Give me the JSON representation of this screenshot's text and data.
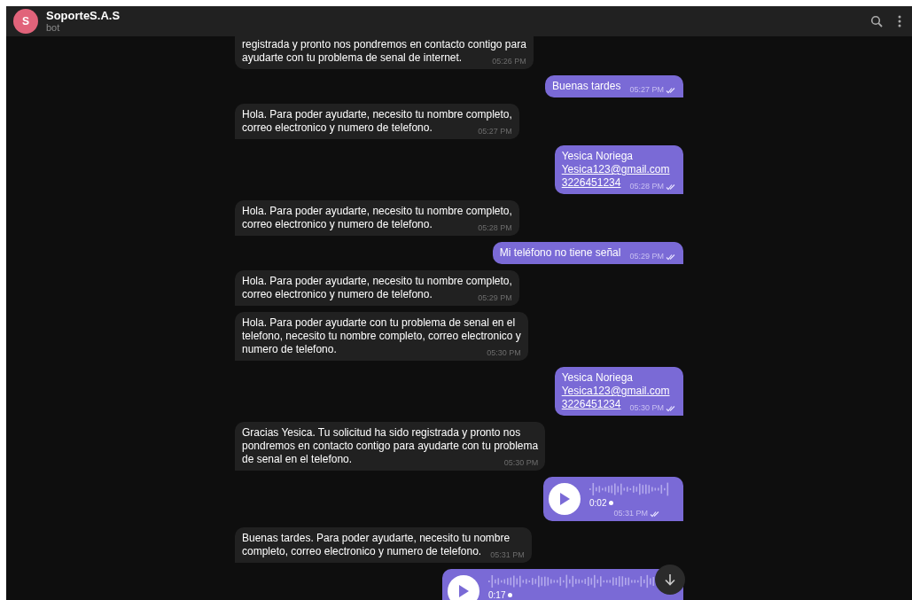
{
  "header": {
    "avatar_letter": "S",
    "title": "SoporteS.A.S",
    "subtitle": "bot"
  },
  "messages": [
    {
      "kind": "text",
      "outgoing": false,
      "lines": [
        {
          "text": "registrada y pronto nos pondremos en contacto contigo para"
        },
        {
          "text": "ayudarte con tu problema de senal de internet."
        }
      ],
      "time": "05:26 PM"
    },
    {
      "kind": "text",
      "outgoing": true,
      "lines": [
        {
          "text": "Buenas tardes"
        }
      ],
      "time": "05:27 PM",
      "read": true
    },
    {
      "kind": "text",
      "outgoing": false,
      "lines": [
        {
          "text": "Hola. Para poder ayudarte, necesito tu nombre completo,"
        },
        {
          "text": "correo electronico y numero de telefono."
        }
      ],
      "time": "05:27 PM"
    },
    {
      "kind": "text",
      "outgoing": true,
      "lines": [
        {
          "text": "Yesica Noriega",
          "link": false
        },
        {
          "text": "Yesica123@gmail.com",
          "link": true
        },
        {
          "text": "3226451234",
          "link": true
        }
      ],
      "time": "05:28 PM",
      "read": true
    },
    {
      "kind": "text",
      "outgoing": false,
      "lines": [
        {
          "text": "Hola. Para poder ayudarte, necesito tu nombre completo,"
        },
        {
          "text": "correo electronico y numero de telefono."
        }
      ],
      "time": "05:28 PM"
    },
    {
      "kind": "text",
      "outgoing": true,
      "lines": [
        {
          "text": "Mi teléfono no tiene señal"
        }
      ],
      "time": "05:29 PM",
      "read": true
    },
    {
      "kind": "text",
      "outgoing": false,
      "lines": [
        {
          "text": "Hola. Para poder ayudarte, necesito tu nombre completo,"
        },
        {
          "text": "correo electronico y numero de telefono."
        }
      ],
      "time": "05:29 PM"
    },
    {
      "kind": "text",
      "outgoing": false,
      "lines": [
        {
          "text": "Hola. Para poder ayudarte con tu problema de senal en el"
        },
        {
          "text": "telefono, necesito tu nombre completo, correo electronico y"
        },
        {
          "text": "numero de telefono."
        }
      ],
      "time": "05:30 PM"
    },
    {
      "kind": "text",
      "outgoing": true,
      "lines": [
        {
          "text": "Yesica Noriega",
          "link": false
        },
        {
          "text": "Yesica123@gmail.com",
          "link": true
        },
        {
          "text": "3226451234",
          "link": true
        }
      ],
      "time": "05:30 PM",
      "read": true
    },
    {
      "kind": "text",
      "outgoing": false,
      "lines": [
        {
          "text": "Gracias Yesica. Tu solicitud ha sido registrada y pronto nos"
        },
        {
          "text": "pondremos en contacto contigo para ayudarte con tu problema"
        },
        {
          "text": "de senal en el telefono."
        }
      ],
      "time": "05:30 PM"
    },
    {
      "kind": "voice",
      "outgoing": true,
      "duration": "0:02",
      "time": "05:31 PM",
      "read": true,
      "wide": false
    },
    {
      "kind": "text",
      "outgoing": false,
      "lines": [
        {
          "text": "Buenas tardes. Para poder ayudarte, necesito tu nombre"
        },
        {
          "text": "completo, correo electronico y numero de telefono."
        }
      ],
      "time": "05:31 PM"
    },
    {
      "kind": "voice",
      "outgoing": true,
      "duration": "0:17",
      "wide": true
    }
  ]
}
